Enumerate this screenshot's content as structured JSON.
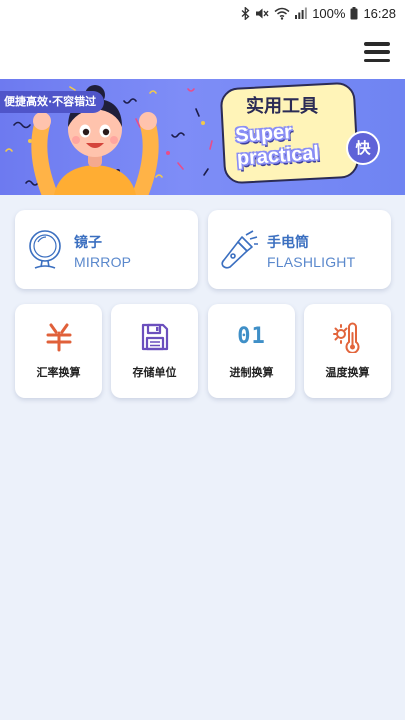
{
  "status_bar": {
    "battery": "100%",
    "time": "16:28",
    "icons": [
      "bluetooth-icon",
      "mute-icon",
      "wifi-icon",
      "signal-icon",
      "battery-icon"
    ]
  },
  "header": {
    "menu_icon": "hamburger-menu-icon"
  },
  "banner": {
    "tag": "便捷高效·不容错过",
    "title": "实用工具",
    "subtitle": "Super practical",
    "badge": "快",
    "colors": {
      "background": "#7482f4",
      "bubble": "#fff4b8",
      "tag": "#4f55c9"
    }
  },
  "tools_primary": [
    {
      "zh": "镜子",
      "en": "MIRROP",
      "icon": "mirror-icon"
    },
    {
      "zh": "手电筒",
      "en": "FLASHLIGHT",
      "icon": "flashlight-icon"
    }
  ],
  "tools_secondary": [
    {
      "label": "汇率换算",
      "icon": "yuan-icon"
    },
    {
      "label": "存储单位",
      "icon": "floppy-disk-icon"
    },
    {
      "label": "进制换算",
      "icon": "binary-icon",
      "icon_text": "01"
    },
    {
      "label": "温度换算",
      "icon": "thermometer-sun-icon"
    }
  ],
  "colors": {
    "page_background": "#ecf1fa",
    "primary_text": "#3b6fc0",
    "secondary_text": "#5a88cc",
    "yuan_icon": "#e0603a",
    "floppy_icon": "#6b4fbd",
    "binary_icon": "#3f8fc7",
    "thermo_icon": "#e2653c"
  }
}
